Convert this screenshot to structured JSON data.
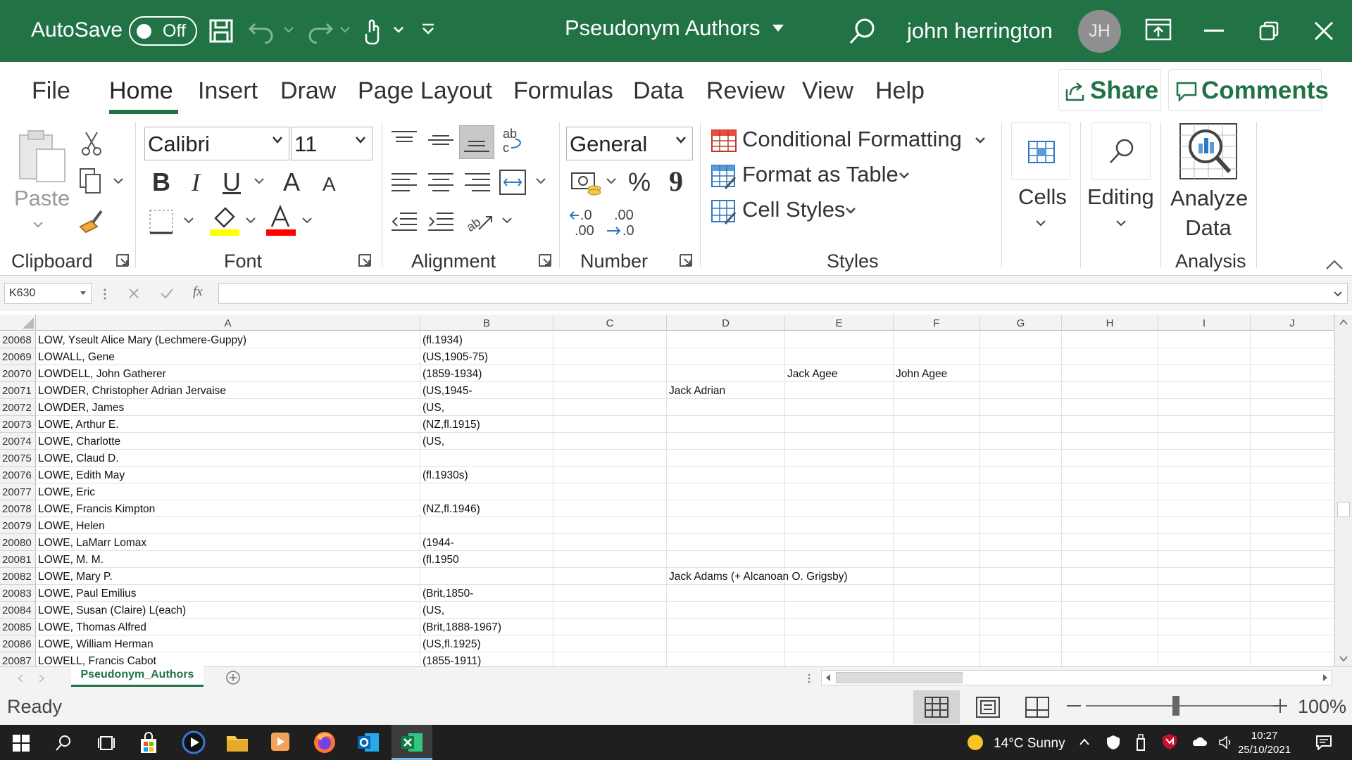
{
  "titlebar": {
    "autosave_label": "AutoSave",
    "autosave_state": "Off",
    "document_title": "Pseudonym Authors",
    "user_name": "john herrington",
    "user_initials": "JH",
    "accent_color": "#217346"
  },
  "ribbon_tabs": [
    {
      "label": "File"
    },
    {
      "label": "Home"
    },
    {
      "label": "Insert"
    },
    {
      "label": "Draw"
    },
    {
      "label": "Page Layout"
    },
    {
      "label": "Formulas"
    },
    {
      "label": "Data"
    },
    {
      "label": "Review"
    },
    {
      "label": "View"
    },
    {
      "label": "Help"
    }
  ],
  "share_label": "Share",
  "comments_label": "Comments",
  "clipboard": {
    "paste_label": "Paste",
    "group_label": "Clipboard"
  },
  "font": {
    "name": "Calibri",
    "size": "11",
    "group_label": "Font",
    "increase": "A",
    "decrease": "A",
    "highlight_color": "#ffff00",
    "font_color": "#ff0000"
  },
  "alignment": {
    "group_label": "Alignment"
  },
  "number": {
    "format": "General",
    "group_label": "Number",
    "percent": "%",
    "comma": "9",
    "inc_decimal": ".0\n.00",
    "dec_decimal": ".00\n.0"
  },
  "styles": {
    "conditional": "Conditional Formatting",
    "format_table": "Format as Table",
    "cell_styles": "Cell Styles",
    "group_label": "Styles"
  },
  "cells_label": "Cells",
  "editing_label": "Editing",
  "analyze": {
    "label_line1": "Analyze",
    "label_line2": "Data",
    "group_label": "Analysis"
  },
  "formula_bar": {
    "name_box": "K630",
    "fx": "fx",
    "formula": ""
  },
  "columns": [
    "A",
    "B",
    "C",
    "D",
    "E",
    "F",
    "G",
    "H",
    "I",
    "J"
  ],
  "rows": [
    {
      "num": "20068",
      "A": "LOW, Yseult Alice Mary (Lechmere-Guppy)",
      "B": "(fl.1934)",
      "D": "",
      "E": "",
      "F": ""
    },
    {
      "num": "20069",
      "A": "LOWALL, Gene",
      "B": "(US,1905-75)",
      "D": "",
      "E": "",
      "F": ""
    },
    {
      "num": "20070",
      "A": "LOWDELL, John Gatherer",
      "B": "(1859-1934)",
      "D": "",
      "E": "Jack Agee",
      "F": "John Agee"
    },
    {
      "num": "20071",
      "A": "LOWDER, Christopher Adrian Jervaise",
      "B": "(US,1945-",
      "D": "Jack Adrian",
      "E": "",
      "F": ""
    },
    {
      "num": "20072",
      "A": "LOWDER, James",
      "B": "(US,",
      "D": "",
      "E": "",
      "F": ""
    },
    {
      "num": "20073",
      "A": "LOWE, Arthur E.",
      "B": "(NZ,fl.1915)",
      "D": "",
      "E": "",
      "F": ""
    },
    {
      "num": "20074",
      "A": "LOWE, Charlotte",
      "B": "(US,",
      "D": "",
      "E": "",
      "F": ""
    },
    {
      "num": "20075",
      "A": "LOWE, Claud D.",
      "B": "",
      "D": "",
      "E": "",
      "F": ""
    },
    {
      "num": "20076",
      "A": "LOWE, Edith May",
      "B": "(fl.1930s)",
      "D": "",
      "E": "",
      "F": ""
    },
    {
      "num": "20077",
      "A": "LOWE, Eric",
      "B": "",
      "D": "",
      "E": "",
      "F": ""
    },
    {
      "num": "20078",
      "A": "LOWE, Francis Kimpton",
      "B": "(NZ,fl.1946)",
      "D": "",
      "E": "",
      "F": ""
    },
    {
      "num": "20079",
      "A": "LOWE, Helen",
      "B": "",
      "D": "",
      "E": "",
      "F": ""
    },
    {
      "num": "20080",
      "A": "LOWE, LaMarr Lomax",
      "B": "(1944-",
      "D": "",
      "E": "",
      "F": ""
    },
    {
      "num": "20081",
      "A": "LOWE, M. M.",
      "B": "(fl.1950",
      "D": "",
      "E": "",
      "F": ""
    },
    {
      "num": "20082",
      "A": "LOWE, Mary P.",
      "B": "",
      "D": "Jack Adams (+ Alcanoan O. Grigsby)",
      "E": "",
      "F": ""
    },
    {
      "num": "20083",
      "A": "LOWE, Paul Emilius",
      "B": "(Brit,1850-",
      "D": "",
      "E": "",
      "F": ""
    },
    {
      "num": "20084",
      "A": "LOWE, Susan (Claire) L(each)",
      "B": "(US,",
      "D": "",
      "E": "",
      "F": ""
    },
    {
      "num": "20085",
      "A": "LOWE, Thomas Alfred",
      "B": "(Brit,1888-1967)",
      "D": "",
      "E": "",
      "F": ""
    },
    {
      "num": "20086",
      "A": "LOWE, William Herman",
      "B": "(US,fl.1925)",
      "D": "",
      "E": "",
      "F": ""
    },
    {
      "num": "20087",
      "A": "LOWELL, Francis Cabot",
      "B": "(1855-1911)",
      "D": "",
      "E": "",
      "F": ""
    }
  ],
  "sheet_tab": "Pseudonym_Authors",
  "status": {
    "text": "Ready",
    "zoom": "100%"
  },
  "taskbar": {
    "weather": "14°C  Sunny",
    "time": "10:27",
    "date": "25/10/2021"
  }
}
